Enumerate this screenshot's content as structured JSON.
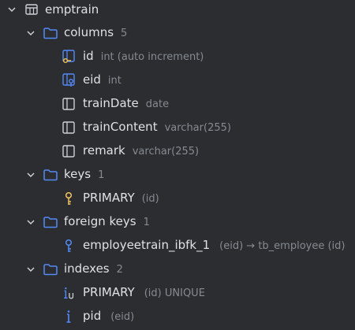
{
  "table": {
    "name": "emptrain"
  },
  "columns": {
    "label": "columns",
    "count": "5",
    "items": [
      {
        "name": "id",
        "type": "int (auto increment)",
        "icon": "primary-key-column-icon"
      },
      {
        "name": "eid",
        "type": "int",
        "icon": "foreign-key-column-icon"
      },
      {
        "name": "trainDate",
        "type": "date",
        "icon": "column-icon"
      },
      {
        "name": "trainContent",
        "type": "varchar(255)",
        "icon": "column-icon"
      },
      {
        "name": "remark",
        "type": "varchar(255)",
        "icon": "column-icon"
      }
    ]
  },
  "keys": {
    "label": "keys",
    "count": "1",
    "items": [
      {
        "name": "PRIMARY",
        "detail": "(id)",
        "icon": "primary-key-icon"
      }
    ]
  },
  "foreign_keys": {
    "label": "foreign keys",
    "count": "1",
    "items": [
      {
        "name": "employeetrain_ibfk_1",
        "detail": "(eid) → tb_employee (id)",
        "icon": "foreign-key-icon"
      }
    ]
  },
  "indexes": {
    "label": "indexes",
    "count": "2",
    "items": [
      {
        "name": "PRIMARY",
        "detail": "(id) UNIQUE",
        "icon": "unique-index-icon"
      },
      {
        "name": "pid",
        "detail": "(eid)",
        "icon": "index-icon"
      }
    ]
  },
  "colors": {
    "background": "#2b2d30",
    "text": "#dfe1e5",
    "hint": "#868a91",
    "folder_blue": "#548af7",
    "key_gold": "#f2c55c"
  }
}
